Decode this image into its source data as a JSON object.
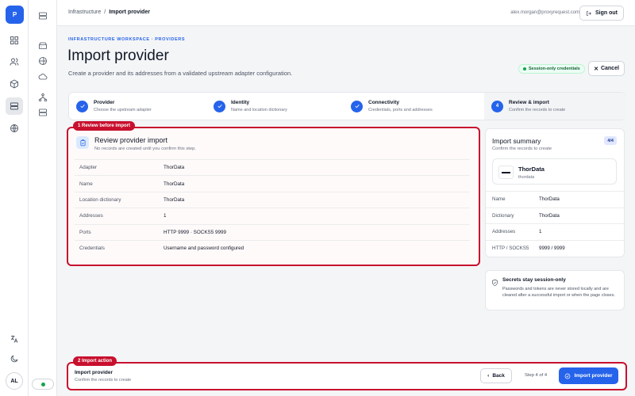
{
  "app": {
    "logo_letter": "P"
  },
  "user": {
    "email": "alex.morgan@proxyrequest.com",
    "initials": "AL",
    "sign_out_label": "Sign out"
  },
  "breadcrumb": {
    "parent": "Infrastructure",
    "separator": "/",
    "current": "Import provider"
  },
  "header": {
    "eyebrow": "INFRASTRUCTURE WORKSPACE · PROVIDERS",
    "title": "Import provider",
    "description": "Create a provider and its addresses from a validated upstream adapter configuration.",
    "session_badge": "Session-only credentials",
    "cancel_label": "Cancel"
  },
  "stepper": {
    "steps": [
      {
        "number": "1",
        "title": "Provider",
        "subtitle": "Choose the upstream adapter",
        "state": "done"
      },
      {
        "number": "2",
        "title": "Identity",
        "subtitle": "Name and location dictionary",
        "state": "done"
      },
      {
        "number": "3",
        "title": "Connectivity",
        "subtitle": "Credentials, ports and addresses",
        "state": "done"
      },
      {
        "number": "4",
        "title": "Review & import",
        "subtitle": "Confirm the records to create",
        "state": "current"
      }
    ]
  },
  "callouts": {
    "review": "1 Review before import",
    "action": "2 Import action"
  },
  "review": {
    "title": "Review provider import",
    "subtitle": "No records are created until you confirm this step.",
    "rows": [
      {
        "label": "Adapter",
        "value": "ThorData"
      },
      {
        "label": "Name",
        "value": "ThorData"
      },
      {
        "label": "Location dictionary",
        "value": "ThorData"
      },
      {
        "label": "Addresses",
        "value": "1"
      },
      {
        "label": "Ports",
        "value": "HTTP 9999 · SOCKS5 9999"
      },
      {
        "label": "Credentials",
        "value": "Username and password configured"
      }
    ]
  },
  "summary": {
    "title": "Import summary",
    "subtitle": "Confirm the records to create",
    "count": "4/4",
    "provider_name": "ThorData",
    "provider_slug": "thordata",
    "rows": [
      {
        "label": "Name",
        "value": "ThorData"
      },
      {
        "label": "Dictionary",
        "value": "ThorData"
      },
      {
        "label": "Addresses",
        "value": "1"
      },
      {
        "label": "HTTP / SOCKS5",
        "value": "9999 / 9999"
      }
    ]
  },
  "secrets": {
    "title": "Secrets stay session-only",
    "body": "Passwords and tokens are never stored locally and are cleared after a successful import or when the page closes."
  },
  "action_bar": {
    "title": "Import provider",
    "subtitle": "Confirm the records to create",
    "back_label": "Back",
    "step_indicator": "Step 4 of 4",
    "import_label": "Import provider"
  },
  "colors": {
    "accent": "#2563eb",
    "callout": "#c8102e",
    "success": "#16a34a"
  }
}
